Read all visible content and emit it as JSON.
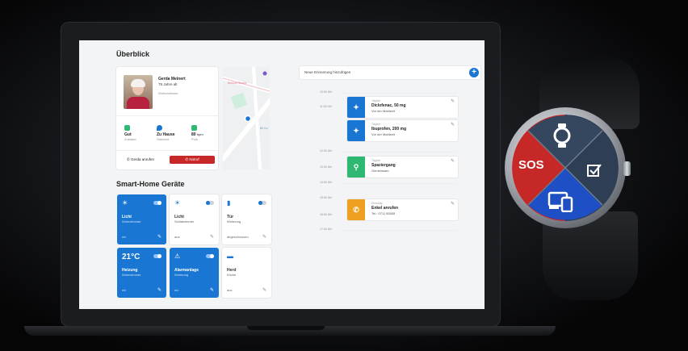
{
  "overview": {
    "title": "Überblick",
    "profile": {
      "name": "Gerda Meinert",
      "age": "78 Jahre alt",
      "detail": "Wohnadresse"
    },
    "stats": [
      {
        "value": "Gut",
        "label": "Zustand",
        "color": "#2eb872",
        "icon": "heart-icon"
      },
      {
        "value": "Zu Hause",
        "label": "Standort",
        "color": "#1976d2",
        "icon": "location-pin-icon"
      },
      {
        "value": "80",
        "unit": "bpm",
        "label": "Puls",
        "color": "#2eb872",
        "icon": "pulse-icon"
      }
    ],
    "call_button": "Gerda anrufen",
    "emergency_button": "Notruf",
    "map_label": "Berliner Straße",
    "map_area": "Bri Ku"
  },
  "smarthome": {
    "title": "Smart-Home Geräte",
    "tiles": [
      {
        "icon": "lightbulb-icon",
        "glyph": "☀",
        "name": "Licht",
        "room": "Wohnzimmer",
        "foot": "ein",
        "state": "on"
      },
      {
        "icon": "lightbulb-icon",
        "glyph": "☀",
        "name": "Licht",
        "room": "Schlafzimmer",
        "foot": "aus",
        "state": "off"
      },
      {
        "icon": "door-icon",
        "glyph": "▮",
        "name": "Tür",
        "room": "Wohnung",
        "foot": "abgeschlossen",
        "state": "off"
      },
      {
        "big": "21°C",
        "name": "Heizung",
        "room": "Wohnzimmer",
        "foot": "ein",
        "state": "on"
      },
      {
        "icon": "alarm-icon",
        "glyph": "⚠",
        "name": "Alarmanlage",
        "room": "Wohnung",
        "foot": "ein",
        "state": "on"
      },
      {
        "icon": "stove-icon",
        "glyph": "▬",
        "name": "Herd",
        "room": "Küche",
        "foot": "aus",
        "state": "off"
      }
    ]
  },
  "reminders": {
    "add_label": "Neue Erinnerung hinzufügen",
    "times": [
      "10:00 Uhr",
      "11:00 Uhr",
      "12:00 Uhr",
      "13:00 Uhr",
      "14:00 Uhr",
      "15:00 Uhr",
      "16:00 Uhr",
      "17:00 Uhr"
    ],
    "events": [
      {
        "tag": "Täglich",
        "title": "Diclofenac, 50 mg",
        "sub": "Vor der Mahlzeit",
        "color": "#1976d2",
        "icon": "pill-icon"
      },
      {
        "tag": "Täglich",
        "title": "Ibuprofen, 200 mg",
        "sub": "Vor der Mahlzeit",
        "color": "#1976d2",
        "icon": "pill-icon"
      },
      {
        "tag": "Täglich",
        "title": "Spaziergang",
        "sub": "Gemeinsam",
        "color": "#2eb872",
        "icon": "walk-icon"
      },
      {
        "tag": "Einmalig",
        "title": "Enkel anrufen",
        "sub": "Tel.: 0711 55555",
        "color": "#f0a020",
        "icon": "phone-icon"
      }
    ]
  },
  "watch": {
    "sos_label": "SOS",
    "colors": {
      "red": "#c62828",
      "blue": "#1e4fc4",
      "slate": "#2e3e55"
    }
  }
}
